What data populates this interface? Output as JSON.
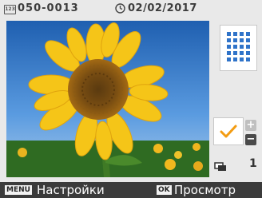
{
  "top": {
    "file_icon_text": "123",
    "file_number": "050-0013",
    "date": "02/02/2017"
  },
  "side": {
    "copies": "1"
  },
  "bottom": {
    "menu_tag": "MENU",
    "menu_label": "Настройки",
    "ok_tag": "OK",
    "ok_label": "Просмотр"
  },
  "colors": {
    "accent_orange": "#f39c12",
    "index_blue": "#2f73c9",
    "topbar_text": "#3c3c3c"
  }
}
